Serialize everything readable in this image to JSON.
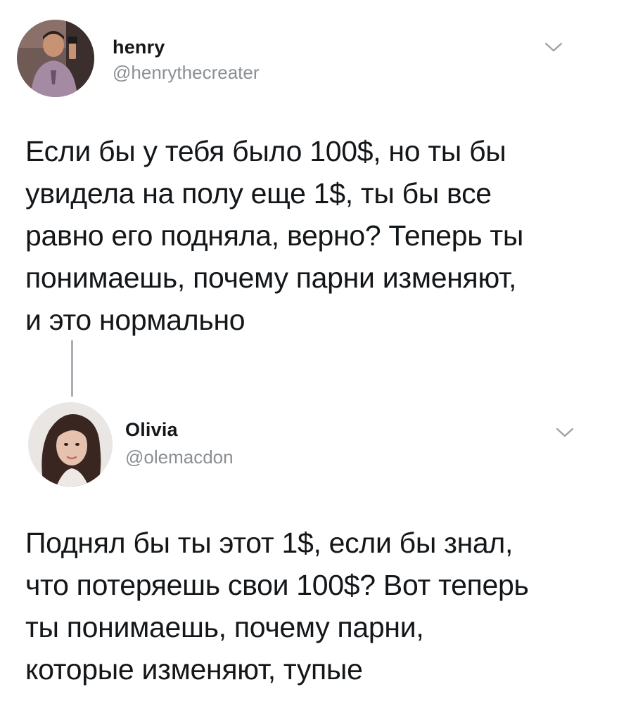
{
  "tweets": [
    {
      "display_name": "henry",
      "handle": "@henrythecreater",
      "text": "Если бы у тебя было 100$, но ты бы\nувидела на полу еще 1$, ты бы все\nравно его подняла, верно? Теперь ты\nпонимаешь, почему парни изменяют,\nи это нормально"
    },
    {
      "display_name": "Olivia",
      "handle": "@olemacdon",
      "text": "Поднял бы ты этот 1$, если бы знал,\nчто потеряешь свои 100$? Вот теперь\nты понимаешь, почему парни,\nкоторые изменяют, тупые"
    }
  ],
  "colors": {
    "text": "#14171a",
    "secondary": "#8a8f94",
    "thread_line": "#a9afb4"
  },
  "icons": {
    "menu_chevron": "chevron-down-icon"
  }
}
